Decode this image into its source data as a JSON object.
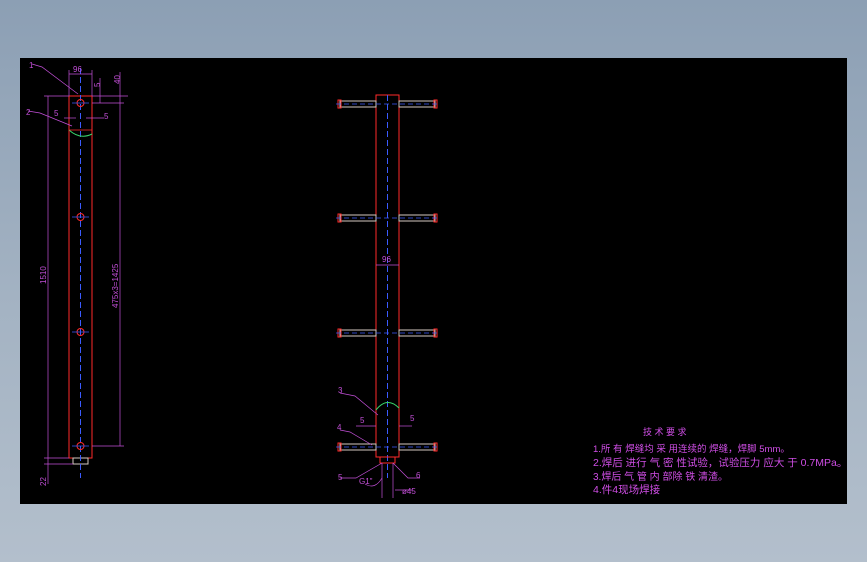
{
  "drawing": {
    "colors": {
      "background": "#000000",
      "outline": "#ff2a2a",
      "centerline": "#3b5bff",
      "dimension": "#c34fd8",
      "weld_arc": "#39d66b",
      "pipe_fill": "#d4c9bf"
    },
    "left_view": {
      "callouts": {
        "part1": "1",
        "part2": "2"
      },
      "dims": {
        "width_96": "96",
        "top_5": "5",
        "top_40": "40",
        "inner_5_left": "5",
        "inner_5_right": "5",
        "total_length": "1510",
        "spacing": "475x3=1425",
        "bottom_22": "22"
      }
    },
    "right_view": {
      "callouts": {
        "part3": "3",
        "part4": "4",
        "part5": "5",
        "part6": "6"
      },
      "dims": {
        "width_96": "96",
        "gap_5_left": "5",
        "gap_5_right": "5",
        "angle": "G1\"",
        "diameter": "ø45"
      }
    },
    "notes": {
      "title": "技 术 要 求",
      "items": [
        "1.所 有 焊缝均 采 用连续的 焊缝，焊脚 5mm。",
        "2.焊后 进行 气 密 性试验，试验压力 应大 于 0.7MPa。",
        "3.焊后 气 管 内 部除 铁 清渣。",
        "4.件4现场焊接"
      ]
    }
  }
}
